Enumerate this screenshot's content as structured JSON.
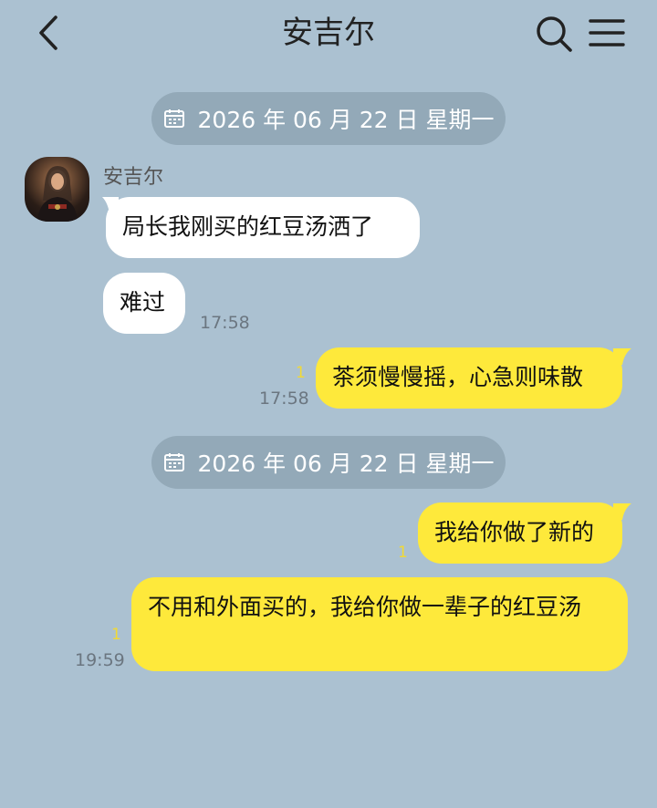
{
  "header": {
    "title": "安吉尔"
  },
  "icons": {
    "back": "chevron-left-icon",
    "search": "search-icon",
    "menu": "menu-icon",
    "calendar": "calendar-icon"
  },
  "colors": {
    "background": "#abc1d1",
    "incoming_bubble": "#ffffff",
    "outgoing_bubble": "#fee93b",
    "date_pill": "#93a9b8",
    "unread_count": "#f1d936"
  },
  "date_separators": [
    {
      "label": "2026 年 06 月 22 日 星期一"
    },
    {
      "label": "2026 年 06 月 22 日 星期一"
    }
  ],
  "messages": [
    {
      "direction": "in",
      "sender": "安吉尔",
      "text": "局长我刚买的红豆汤洒了"
    },
    {
      "direction": "in",
      "text": "难过",
      "time": "17:58"
    },
    {
      "direction": "out",
      "text": "茶须慢慢摇，心急则味散",
      "time": "17:58",
      "unread": "1"
    },
    {
      "direction": "out",
      "text": "我给你做了新的",
      "unread": "1"
    },
    {
      "direction": "out",
      "text": "不用和外面买的，我给你做一辈子的红豆汤",
      "time": "19:59",
      "unread": "1"
    }
  ]
}
